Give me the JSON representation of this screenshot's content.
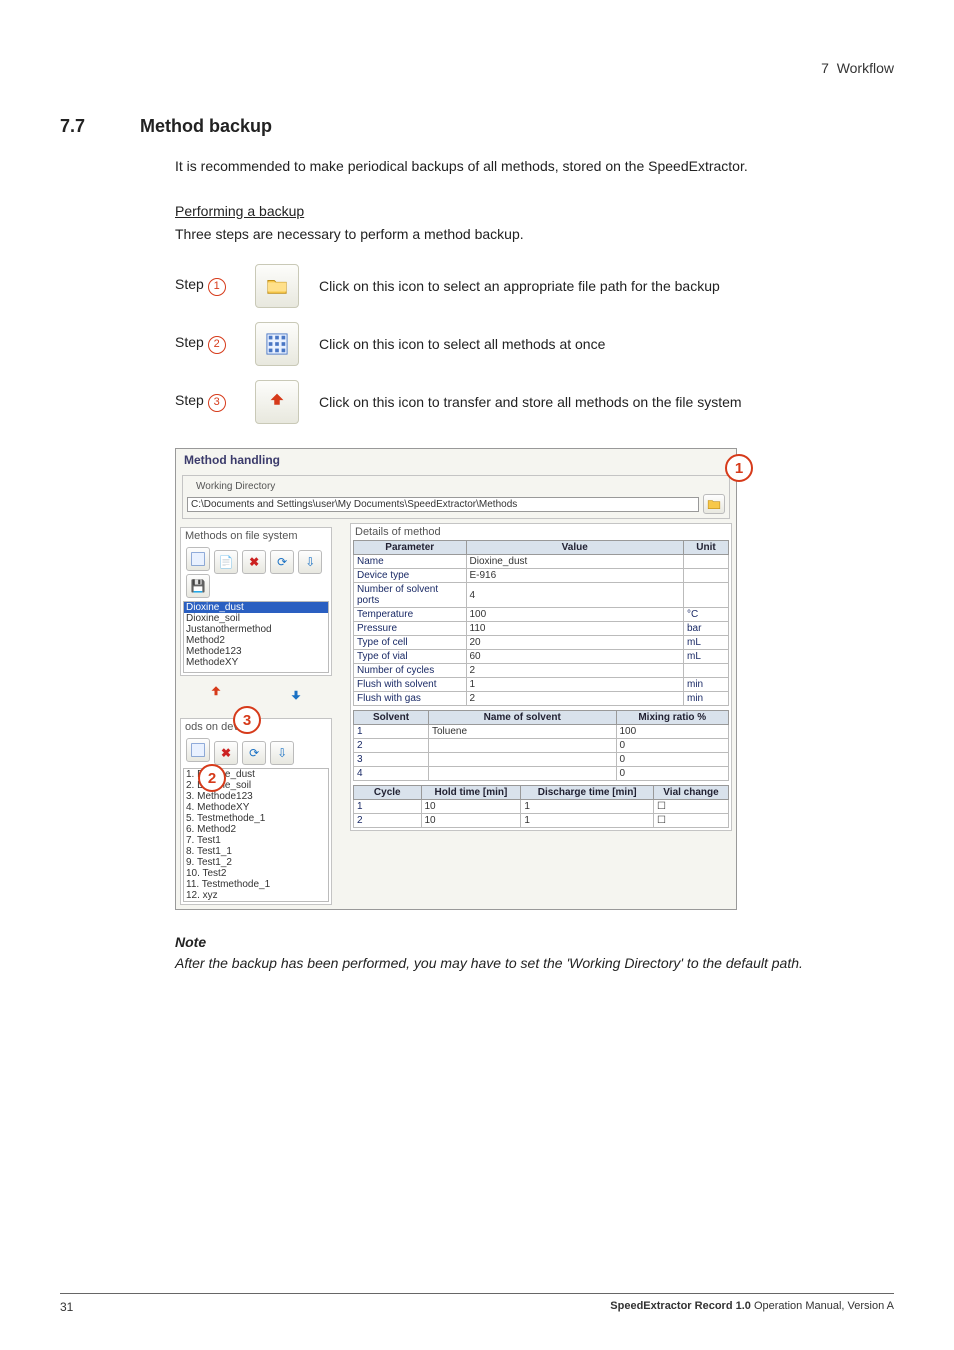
{
  "header": {
    "chapter": "7",
    "chapter_title": "Workflow"
  },
  "section": {
    "number": "7.7",
    "title": "Method backup"
  },
  "intro": "It is recommended to make periodical backups of all methods, stored on the SpeedExtractor.",
  "subheading": "Performing a backup",
  "subtext": "Three steps are necessary to perform a method backup.",
  "steps": [
    {
      "label": "Step",
      "num": "1",
      "desc": "Click on this icon to select an appropriate file path for the backup"
    },
    {
      "label": "Step",
      "num": "2",
      "desc": "Click on this icon to select all methods at once"
    },
    {
      "label": "Step",
      "num": "3",
      "desc": "Click on this icon to transfer and store all methods on the file system"
    }
  ],
  "shot": {
    "title": "Method handling",
    "wd_legend": "Working Directory",
    "path": "C:\\Documents and Settings\\user\\My Documents\\SpeedExtractor\\Methods",
    "fs_legend": "Methods on file system",
    "fs_list": [
      "Dioxine_dust",
      "Dioxine_soil",
      "Justanothermethod",
      "Method2",
      "Methode123",
      "MethodeXY"
    ],
    "dev_legend": "ods on device",
    "dev_list": [
      "1. Dioxine_dust",
      "2. Dioxine_soil",
      "3. Methode123",
      "4. MethodeXY",
      "5. Testmethode_1",
      "6. Method2",
      "7. Test1",
      "8. Test1_1",
      "9. Test1_2",
      "10. Test2",
      "11. Testmethode_1",
      "12. xyz"
    ],
    "details_legend": "Details of method",
    "param_h": [
      "Parameter",
      "Value",
      "Unit"
    ],
    "params": [
      {
        "p": "Name",
        "v": "Dioxine_dust",
        "u": ""
      },
      {
        "p": "Device type",
        "v": "E-916",
        "u": ""
      },
      {
        "p": "Number of solvent ports",
        "v": "4",
        "u": ""
      },
      {
        "p": "Temperature",
        "v": "100",
        "u": "°C"
      },
      {
        "p": "Pressure",
        "v": "110",
        "u": "bar"
      },
      {
        "p": "Type of cell",
        "v": "20",
        "u": "mL"
      },
      {
        "p": "Type of vial",
        "v": "60",
        "u": "mL"
      },
      {
        "p": "Number of cycles",
        "v": "2",
        "u": ""
      },
      {
        "p": "Flush with solvent",
        "v": "1",
        "u": "min"
      },
      {
        "p": "Flush with gas",
        "v": "2",
        "u": "min"
      }
    ],
    "solvent_h": [
      "Solvent",
      "Name of solvent",
      "Mixing ratio %"
    ],
    "solvents": [
      {
        "s": "1",
        "n": "Toluene",
        "m": "100"
      },
      {
        "s": "2",
        "n": "",
        "m": "0"
      },
      {
        "s": "3",
        "n": "",
        "m": "0"
      },
      {
        "s": "4",
        "n": "",
        "m": "0"
      }
    ],
    "cycle_h": [
      "Cycle",
      "Hold time [min]",
      "Discharge time [min]",
      "Vial change"
    ],
    "cycles": [
      {
        "c": "1",
        "h": "10",
        "d": "1",
        "v": ""
      },
      {
        "c": "2",
        "h": "10",
        "d": "1",
        "v": ""
      }
    ]
  },
  "overlays": {
    "o1": "1",
    "o2": "2",
    "o3": "3"
  },
  "note": {
    "head": "Note",
    "body": "After the backup has been performed, you may have to set the 'Working Directory' to the default path."
  },
  "footer": {
    "page": "31",
    "product": "SpeedExtractor Record 1.0",
    "tail": " Operation Manual, Version A"
  }
}
